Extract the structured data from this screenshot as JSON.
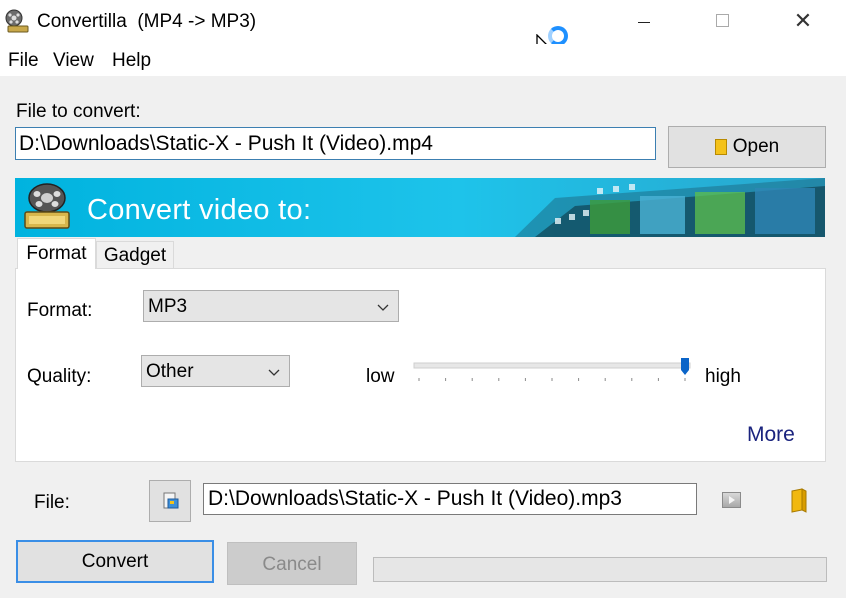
{
  "window": {
    "title": "Convertilla  (MP4 -> MP3)",
    "minimize_symbol": "",
    "maximize_symbol": "",
    "close_symbol": "✕"
  },
  "menu": {
    "items": [
      "File",
      "View",
      "Help"
    ]
  },
  "source": {
    "label": "File to convert:",
    "path": "D:\\Downloads\\Static-X - Push It (Video).mp4",
    "open_label": "Open"
  },
  "banner": {
    "text": "Convert video to:"
  },
  "tabs": [
    {
      "label": "Format",
      "active": true
    },
    {
      "label": "Gadget",
      "active": false
    }
  ],
  "format_tab": {
    "format_label": "Format:",
    "format_value": "MP3",
    "quality_label": "Quality:",
    "quality_value": "Other",
    "low_label": "low",
    "high_label": "high",
    "quality_level": 1.0,
    "more_label": "More"
  },
  "output": {
    "label": "File:",
    "path": "D:\\Downloads\\Static-X - Push It (Video).mp3"
  },
  "actions": {
    "convert_label": "Convert",
    "cancel_label": "Cancel",
    "progress": 0
  },
  "colors": {
    "accent": "#3a8ee6",
    "banner": "#00b3df",
    "link": "#1a237e",
    "slider_thumb": "#0a64c8"
  },
  "icons": {
    "app": "film-reel-icon",
    "open": "folder-icon",
    "choose_output": "file-icon",
    "play": "play-icon",
    "open_folder": "folder-icon"
  }
}
